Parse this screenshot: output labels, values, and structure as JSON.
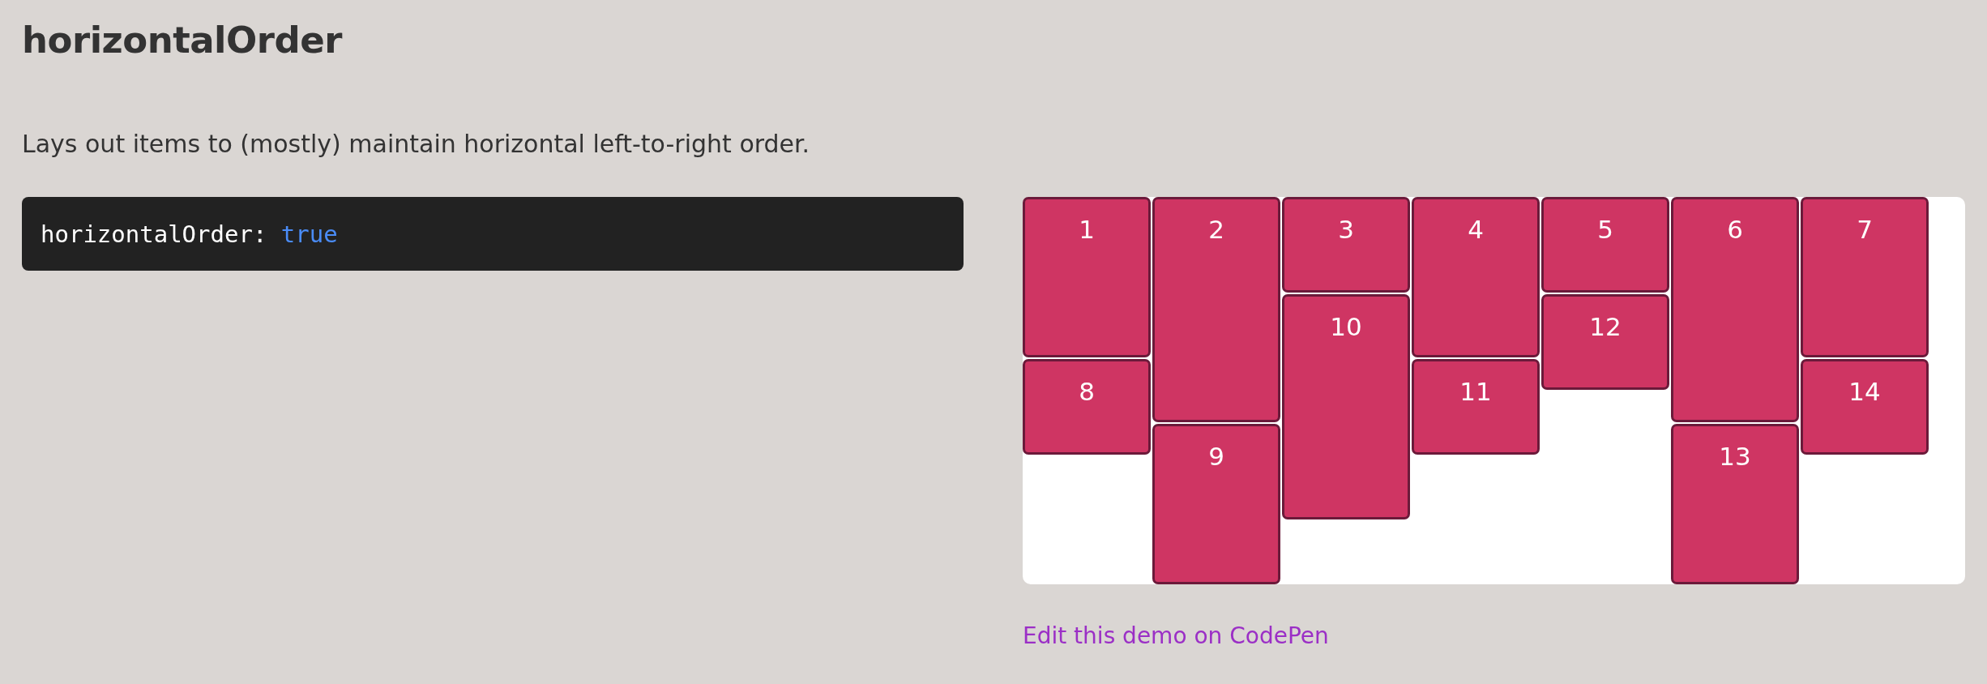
{
  "title": "horizontalOrder",
  "description": "Lays out items to (mostly) maintain horizontal left-to-right order.",
  "code": {
    "property": "horizontalOrder:",
    "value": "true"
  },
  "grid": {
    "items": [
      {
        "label": "1",
        "kind": "medium"
      },
      {
        "label": "2",
        "kind": "tall"
      },
      {
        "label": "3",
        "kind": "short"
      },
      {
        "label": "4",
        "kind": "medium"
      },
      {
        "label": "5",
        "kind": "short"
      },
      {
        "label": "6",
        "kind": "tall"
      },
      {
        "label": "7",
        "kind": "medium"
      },
      {
        "label": "8",
        "kind": "short"
      },
      {
        "label": "9",
        "kind": "medium"
      },
      {
        "label": "10",
        "kind": "tall"
      },
      {
        "label": "11",
        "kind": "short"
      },
      {
        "label": "12",
        "kind": "short"
      },
      {
        "label": "13",
        "kind": "medium"
      },
      {
        "label": "14",
        "kind": "short"
      }
    ]
  },
  "link": "Edit this demo on CodePen"
}
